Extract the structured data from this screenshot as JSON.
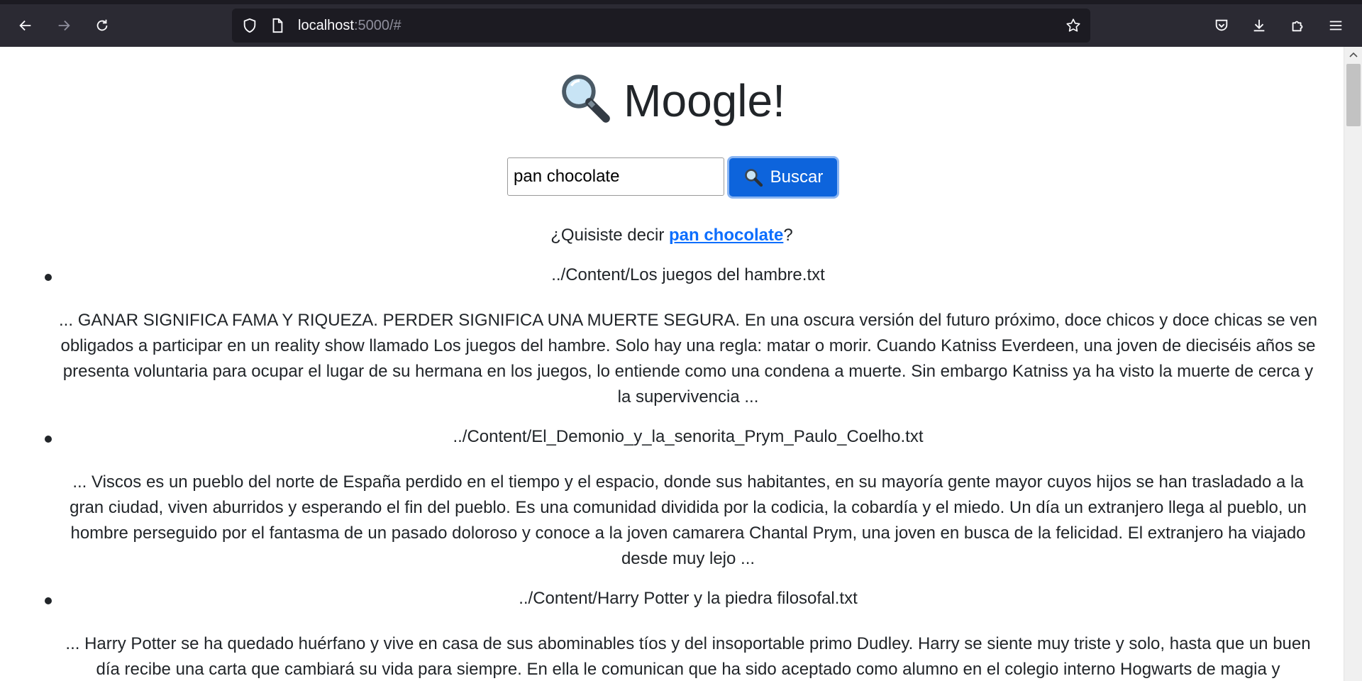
{
  "browser": {
    "url_host": "localhost",
    "url_rest": ":5000/#",
    "icons": {
      "back": "arrow-left-icon",
      "forward": "arrow-right-icon",
      "reload": "reload-icon",
      "shield": "shield-icon",
      "page": "page-icon",
      "bookmark": "star-icon",
      "pocket": "pocket-icon",
      "downloads": "download-icon",
      "extensions": "puzzle-icon",
      "menu": "hamburger-menu-icon"
    }
  },
  "page": {
    "title": "Moogle!",
    "title_icon": "magnifier-icon",
    "search": {
      "value": "pan chocolate",
      "button_label": "Buscar"
    },
    "suggestion": {
      "prefix": "¿Quisiste decir ",
      "link": "pan chocolate",
      "suffix": "?"
    },
    "results": [
      {
        "title": "../Content/Los juegos del hambre.txt",
        "snippet": "...  GANAR SIGNIFICA FAMA Y RIQUEZA. PERDER SIGNIFICA UNA MUERTE  SEGURA. En una oscura versión del futuro próximo, doce chicos y doce chicas se ven obligados a participar en un reality show llamado Los juegos del hambre. Solo hay una regla: matar o morir. Cuando Katniss Everdeen, una joven de dieciséis años se presenta voluntaria para ocupar el lugar de su hermana en los juegos, lo entiende como una condena a muerte. Sin embargo Katniss ya ha visto la muerte de cerca y la supervivencia ..."
      },
      {
        "title": "../Content/El_Demonio_y_la_senorita_Prym_Paulo_Coelho.txt",
        "snippet": "... Viscos es un pueblo del norte de España perdido en el tiempo y el espacio, donde sus habitantes, en su mayoría gente mayor cuyos hijos se han trasladado a la gran ciudad, viven aburridos y esperando el fin del pueblo. Es una comunidad dividida por la codicia, la cobardía y el miedo. Un día un extranjero llega al pueblo, un hombre perseguido por el fantasma de un pasado doloroso y conoce a la joven camarera Chantal Prym, una joven en busca de la felicidad. El extranjero ha viajado desde muy lejo ..."
      },
      {
        "title": "../Content/Harry Potter y la piedra filosofal.txt",
        "snippet": "...  Harry Potter se ha quedado huérfano y vive en casa de sus abominables tíos y del insoportable primo Dudley. Harry se siente muy triste y solo, hasta que un buen día recibe una carta que cambiará su vida para siempre. En ella le comunican que ha sido aceptado como alumno en el colegio interno Hogwarts de magia y"
      }
    ]
  }
}
